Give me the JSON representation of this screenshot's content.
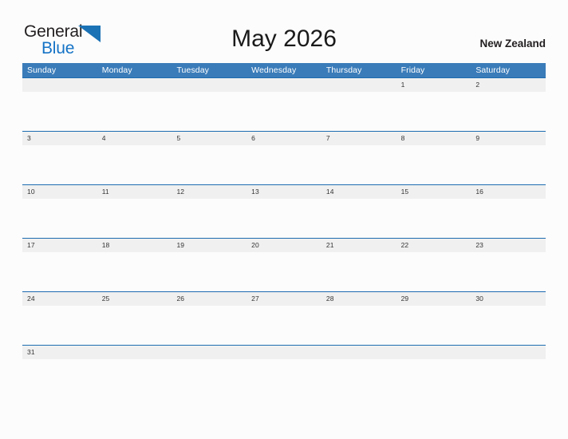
{
  "brand": {
    "name_part1": "General",
    "name_part2": "Blue",
    "triangle_icon": "triangle-icon",
    "color_dark": "#231f20",
    "color_blue": "#1573c6",
    "color_triangle": "#1b72b5"
  },
  "header": {
    "title": "May 2026",
    "locale": "New Zealand"
  },
  "theme": {
    "header_blue": "#3a7cb9",
    "week_rule_blue": "#1d6cb1",
    "date_band_gray": "#f0f0f0",
    "page_background": "#fcfcfc",
    "date_text": "#333333"
  },
  "calendar": {
    "month": "May",
    "year": "2026",
    "day_headers": [
      "Sunday",
      "Monday",
      "Tuesday",
      "Wednesday",
      "Thursday",
      "Friday",
      "Saturday"
    ],
    "weeks": [
      [
        "",
        "",
        "",
        "",
        "",
        "1",
        "2"
      ],
      [
        "3",
        "4",
        "5",
        "6",
        "7",
        "8",
        "9"
      ],
      [
        "10",
        "11",
        "12",
        "13",
        "14",
        "15",
        "16"
      ],
      [
        "17",
        "18",
        "19",
        "20",
        "21",
        "22",
        "23"
      ],
      [
        "24",
        "25",
        "26",
        "27",
        "28",
        "29",
        "30"
      ],
      [
        "31",
        "",
        "",
        "",
        "",
        "",
        ""
      ]
    ]
  }
}
